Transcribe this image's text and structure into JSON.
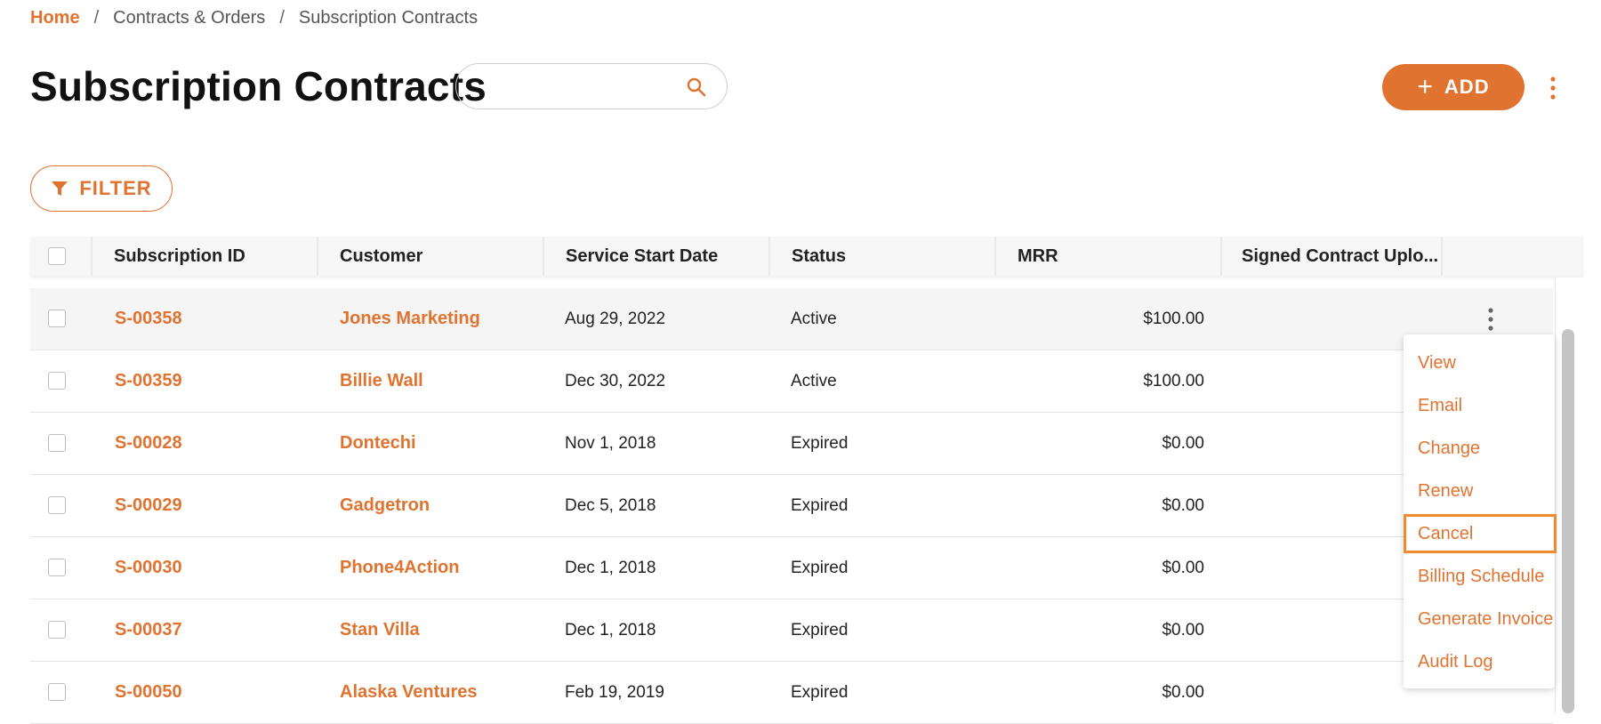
{
  "breadcrumb": {
    "home": "Home",
    "separator": "/",
    "section": "Contracts & Orders",
    "current": "Subscription Contracts"
  },
  "header": {
    "title": "Subscription Contracts",
    "search_value": "",
    "add_label": "ADD"
  },
  "filter_label": "FILTER",
  "table": {
    "columns": [
      "Subscription ID",
      "Customer",
      "Service Start Date",
      "Status",
      "MRR",
      "Signed Contract Uplo..."
    ],
    "rows": [
      {
        "id": "S-00358",
        "customer": "Jones Marketing",
        "start": "Aug 29, 2022",
        "status": "Active",
        "mrr": "$100.00"
      },
      {
        "id": "S-00359",
        "customer": "Billie Wall",
        "start": "Dec 30, 2022",
        "status": "Active",
        "mrr": "$100.00"
      },
      {
        "id": "S-00028",
        "customer": "Dontechi",
        "start": "Nov 1, 2018",
        "status": "Expired",
        "mrr": "$0.00"
      },
      {
        "id": "S-00029",
        "customer": "Gadgetron",
        "start": "Dec 5, 2018",
        "status": "Expired",
        "mrr": "$0.00"
      },
      {
        "id": "S-00030",
        "customer": "Phone4Action",
        "start": "Dec 1, 2018",
        "status": "Expired",
        "mrr": "$0.00"
      },
      {
        "id": "S-00037",
        "customer": "Stan Villa",
        "start": "Dec 1, 2018",
        "status": "Expired",
        "mrr": "$0.00"
      },
      {
        "id": "S-00050",
        "customer": "Alaska Ventures",
        "start": "Feb 19, 2019",
        "status": "Expired",
        "mrr": "$0.00"
      }
    ]
  },
  "row_menu": {
    "items": [
      "View",
      "Email",
      "Change",
      "Renew",
      "Cancel",
      "Billing Schedule",
      "Generate Invoice",
      "Audit Log"
    ],
    "highlighted": "Cancel"
  },
  "colors": {
    "accent": "#e07330",
    "highlight_border": "#f08a2e"
  }
}
